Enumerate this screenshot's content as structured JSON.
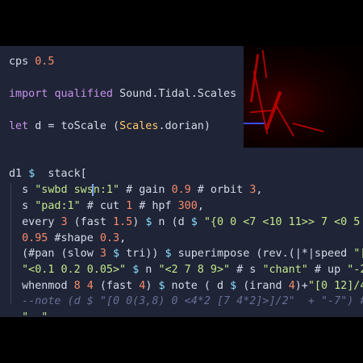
{
  "code_lines": [
    {
      "id": "cps",
      "tokens": [
        {
          "t": "cps ",
          "c": "plain"
        },
        {
          "t": "0.5",
          "c": "num"
        }
      ]
    },
    {
      "id": "import",
      "tokens": [
        {
          "t": "import ",
          "c": "kw"
        },
        {
          "t": "qualified ",
          "c": "kw"
        },
        {
          "t": "Sound.Tidal.Scales a",
          "c": "plain"
        }
      ]
    },
    {
      "id": "let",
      "tokens": [
        {
          "t": "let ",
          "c": "kw"
        },
        {
          "t": "d = toScale (",
          "c": "plain"
        },
        {
          "t": "Scales",
          "c": "mod"
        },
        {
          "t": ".dorian)",
          "c": "plain"
        }
      ]
    },
    {
      "id": "d1",
      "tokens": [
        {
          "t": "d1 ",
          "c": "plain"
        },
        {
          "t": "$",
          "c": "op"
        },
        {
          "t": "  stack[",
          "c": "plain"
        }
      ]
    },
    {
      "id": "s-swbd",
      "tokens": [
        {
          "t": "  s ",
          "c": "plain"
        },
        {
          "t": "\"swbd swsn:1\"",
          "c": "str"
        },
        {
          "t": " # gain ",
          "c": "plain"
        },
        {
          "t": "0.9",
          "c": "num"
        },
        {
          "t": " # orbit ",
          "c": "plain"
        },
        {
          "t": "3",
          "c": "num"
        },
        {
          "t": ",",
          "c": "plain"
        }
      ]
    },
    {
      "id": "s-pad",
      "tokens": [
        {
          "t": "  s ",
          "c": "plain"
        },
        {
          "t": "\"pad:1\"",
          "c": "str"
        },
        {
          "t": " # cut ",
          "c": "plain"
        },
        {
          "t": "1",
          "c": "num"
        },
        {
          "t": " # hpf ",
          "c": "plain"
        },
        {
          "t": "300",
          "c": "num"
        },
        {
          "t": ",",
          "c": "plain"
        }
      ]
    },
    {
      "id": "every",
      "tokens": [
        {
          "t": "  every ",
          "c": "plain"
        },
        {
          "t": "3",
          "c": "num"
        },
        {
          "t": " (fast ",
          "c": "plain"
        },
        {
          "t": "1.5",
          "c": "num"
        },
        {
          "t": ") ",
          "c": "plain"
        },
        {
          "t": "$",
          "c": "op"
        },
        {
          "t": " n (d ",
          "c": "plain"
        },
        {
          "t": "$",
          "c": "op"
        },
        {
          "t": " ",
          "c": "plain"
        },
        {
          "t": "\"{0 0 <7 <10 11>> 7 <0 5",
          "c": "str"
        }
      ]
    },
    {
      "id": "shape",
      "tokens": [
        {
          "t": "  0.95",
          "c": "num"
        },
        {
          "t": " #shape ",
          "c": "plain"
        },
        {
          "t": "0.3",
          "c": "num"
        },
        {
          "t": ",",
          "c": "plain"
        }
      ]
    },
    {
      "id": "pan",
      "tokens": [
        {
          "t": "  (#pan (slow ",
          "c": "plain"
        },
        {
          "t": "3",
          "c": "num"
        },
        {
          "t": " ",
          "c": "plain"
        },
        {
          "t": "$",
          "c": "op"
        },
        {
          "t": " tri)) ",
          "c": "plain"
        },
        {
          "t": "$",
          "c": "op"
        },
        {
          "t": " superimpose (rev.(|*|speed ",
          "c": "plain"
        },
        {
          "t": "\"[",
          "c": "str"
        }
      ]
    },
    {
      "id": "chant",
      "tokens": [
        {
          "t": "  ",
          "c": "plain"
        },
        {
          "t": "\"<0.1 0.2 0.05>\"",
          "c": "str"
        },
        {
          "t": " ",
          "c": "plain"
        },
        {
          "t": "$",
          "c": "op"
        },
        {
          "t": " n ",
          "c": "plain"
        },
        {
          "t": "\"<2 7 8 9>\"",
          "c": "str"
        },
        {
          "t": " # s ",
          "c": "plain"
        },
        {
          "t": "\"chant\"",
          "c": "str"
        },
        {
          "t": " # up ",
          "c": "plain"
        },
        {
          "t": "\"-2",
          "c": "str"
        }
      ]
    },
    {
      "id": "whenmod",
      "tokens": [
        {
          "t": "  whenmod ",
          "c": "plain"
        },
        {
          "t": "8",
          "c": "num"
        },
        {
          "t": " ",
          "c": "plain"
        },
        {
          "t": "4",
          "c": "num"
        },
        {
          "t": " (fast ",
          "c": "plain"
        },
        {
          "t": "4",
          "c": "num"
        },
        {
          "t": ") ",
          "c": "plain"
        },
        {
          "t": "$",
          "c": "op"
        },
        {
          "t": " note ( d ",
          "c": "plain"
        },
        {
          "t": "$",
          "c": "op"
        },
        {
          "t": " (irand ",
          "c": "plain"
        },
        {
          "t": "4",
          "c": "num"
        },
        {
          "t": ")+",
          "c": "plain"
        },
        {
          "t": "\"[0 12]/4",
          "c": "str"
        }
      ]
    },
    {
      "id": "comment",
      "tokens": [
        {
          "t": "  --note (d $ \"[0 0(3,8) 0 <4*2 [7 4*2]>]/2\"  + \"-7\") #",
          "c": "cmt"
        }
      ]
    },
    {
      "id": "partial",
      "tokens": [
        {
          "t": "  ",
          "c": "plain"
        },
        {
          "t": "\"  \"",
          "c": "str"
        }
      ]
    }
  ],
  "colors": {
    "background": "#1f2436",
    "keyword": "#c792ea",
    "number": "#f78c6c",
    "string": "#c3e88d",
    "module": "#ffcb6b",
    "comment": "#676e95",
    "operator": "#89ddff"
  }
}
